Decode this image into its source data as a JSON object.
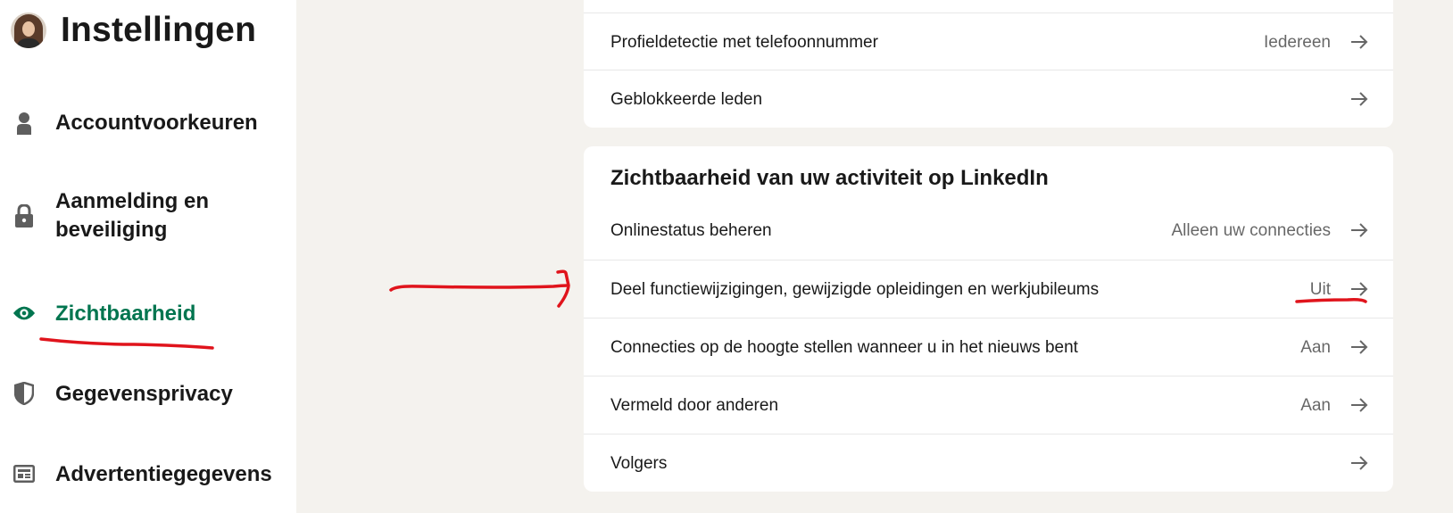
{
  "sidebar": {
    "title": "Instellingen",
    "items": [
      {
        "label": "Accountvoorkeuren",
        "icon": "person-icon"
      },
      {
        "label": "Aanmelding en beveiliging",
        "icon": "lock-icon"
      },
      {
        "label": "Zichtbaarheid",
        "icon": "eye-icon",
        "active": true
      },
      {
        "label": "Gegevensprivacy",
        "icon": "shield-icon"
      },
      {
        "label": "Advertentiegegevens",
        "icon": "ad-data-icon"
      }
    ]
  },
  "top_card": {
    "rows": [
      {
        "label": "Profieldetectie met telefoonnummer",
        "value": "Iedereen"
      },
      {
        "label": "Geblokkeerde leden",
        "value": ""
      }
    ]
  },
  "activity_card": {
    "title": "Zichtbaarheid van uw activiteit op LinkedIn",
    "rows": [
      {
        "label": "Onlinestatus beheren",
        "value": "Alleen uw connecties"
      },
      {
        "label": "Deel functiewijzigingen, gewijzigde opleidingen en werkjubileums",
        "value": "Uit"
      },
      {
        "label": "Connecties op de hoogte stellen wanneer u in het nieuws bent",
        "value": "Aan"
      },
      {
        "label": "Vermeld door anderen",
        "value": "Aan"
      },
      {
        "label": "Volgers",
        "value": ""
      }
    ]
  },
  "colors": {
    "active_accent": "#01754f",
    "annotation": "#e0141c",
    "page_background": "#f4f2ee"
  }
}
